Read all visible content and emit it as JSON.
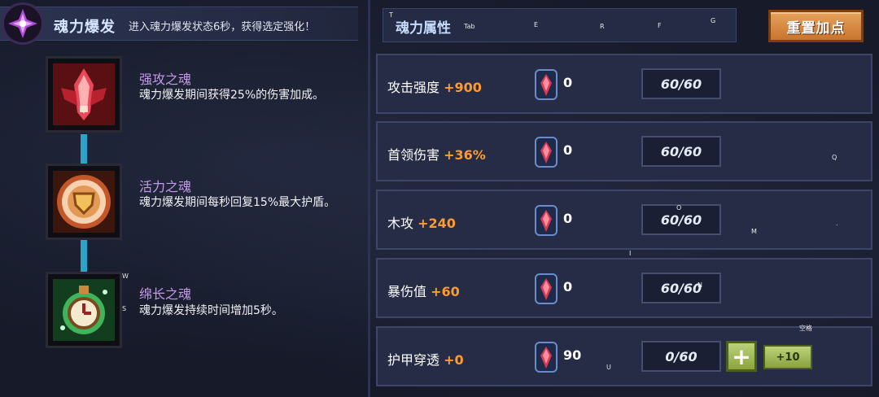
{
  "header": {
    "title": "魂力爆发",
    "description": "进入魂力爆发状态6秒，获得选定强化！"
  },
  "attributes_panel": {
    "title": "魂力属性",
    "reset_label": "重置加点"
  },
  "key_hints": {
    "tab": "Tab",
    "t": "T",
    "e": "E",
    "r": "R",
    "f": "F",
    "g": "G",
    "q": "Q",
    "o": "O",
    "m": "M",
    "dot": ".",
    "i": "I",
    "n": "N",
    "w": "W",
    "s": "S",
    "u": "U",
    "space": "空格"
  },
  "souls": [
    {
      "name": "强攻之魂",
      "description": "魂力爆发期间获得25%的伤害加成。"
    },
    {
      "name": "活力之魂",
      "description": "魂力爆发期间每秒回复15%最大护盾。"
    },
    {
      "name": "绵长之魂",
      "description": "魂力爆发持续时间增加5秒。"
    }
  ],
  "stats": [
    {
      "label": "攻击强度",
      "bonus": "+900",
      "gems": "0",
      "progress": "60/60"
    },
    {
      "label": "首领伤害",
      "bonus": "+36%",
      "gems": "0",
      "progress": "60/60"
    },
    {
      "label": "木攻",
      "bonus": "+240",
      "gems": "0",
      "progress": "60/60"
    },
    {
      "label": "暴伤值",
      "bonus": "+60",
      "gems": "0",
      "progress": "60/60"
    },
    {
      "label": "护甲穿透",
      "bonus": "+0",
      "gems": "90",
      "progress": "0/60"
    }
  ],
  "buttons": {
    "plus": "+",
    "plus10": "+10"
  },
  "colors": {
    "bonus": "#ff9b2e",
    "soul_name": "#c49ae8",
    "reset_button": "#d98b41",
    "plus_button": "#a5bd58",
    "chain": "#2da3c9"
  }
}
